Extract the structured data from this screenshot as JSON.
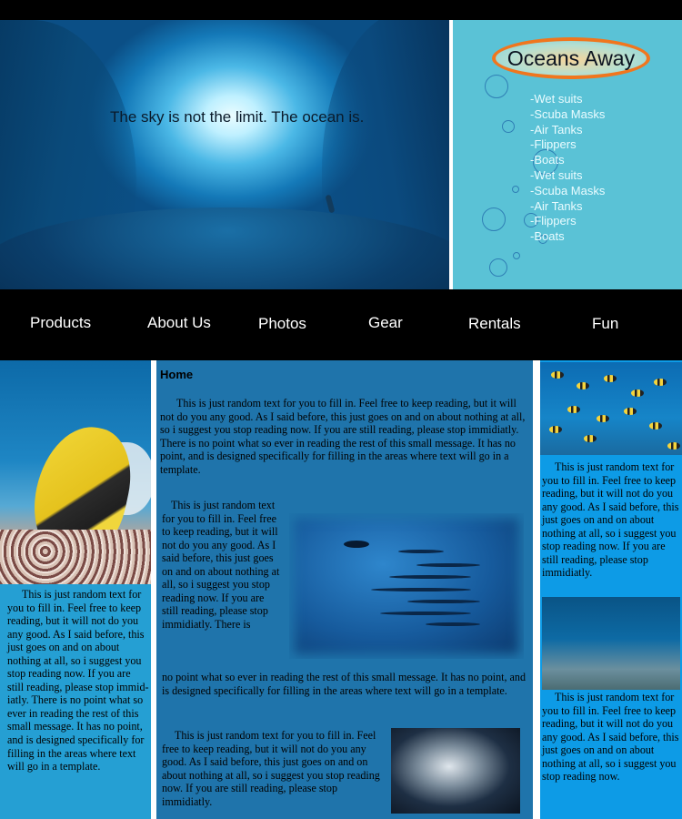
{
  "hero": {
    "tagline": "The sky is not the limit.  The ocean is."
  },
  "sidebar": {
    "logo": "Oceans Away",
    "menu": [
      "-Wet suits",
      "-Scuba Masks",
      "-Air Tanks",
      "-Flippers",
      "-Boats",
      "-Wet suits",
      "-Scuba Masks",
      "-Air Tanks",
      "-Flippers",
      "-Boats"
    ]
  },
  "nav": {
    "items": [
      "Products",
      "About Us",
      "Photos",
      "Gear",
      "Rentals",
      "Fun"
    ]
  },
  "left": {
    "text": "This is just random text for you to fill in.  Feel free to keep reading, but it will not do you any good.  As I said before, this just goes on and on about nothing at all, so i suggest you stop reading now.  If you are still reading, please stop immid-iatly.  There is no point what so ever in reading the rest of this small message.  It has no point, and is designed specifically for filling in the areas where text will go in a template."
  },
  "main": {
    "title": "Home",
    "para1": "This is just random text for you to fill in.  Feel free to keep reading, but it will not do you any good.  As I said before, this just goes on and on about nothing at all, so i suggest you stop reading now.  If you are still reading, please stop immidiatly.  There is no point what so ever in reading the rest of this small message.  It has no point, and is designed specifically for filling in the areas where text will go in a template.",
    "para2a": "This is just random text for you to fill in.  Feel free to keep reading, but it will not do you any good.  As I said before, this just goes on and on about nothing at all, so i suggest you stop reading now.  If you are still reading, please stop immidiatly.  There is",
    "para2b": "no point what so ever in reading the rest of this small message.  It has no point, and is designed specifically for filling in the areas where text will go in a template.",
    "para3": "This is just random text for you to fill in.  Feel free to keep reading, but it will not do you any good.  As I said before, this just goes on and on about nothing at all, so i suggest you stop reading now.  If you are still reading, please stop immidiatly."
  },
  "right": {
    "text1": "This is just random text for you to fill in.  Feel free to keep reading, but it will not do you any good.  As I said before, this just goes on and on about nothing at all, so i suggest you stop reading now.  If you are still reading, please stop immidiatly.",
    "text2": "This is just random text for you to fill in.  Feel free to keep reading, but it will not do you any good.  As I said before, this just goes on and on about nothing at all, so i suggest you stop reading now."
  }
}
